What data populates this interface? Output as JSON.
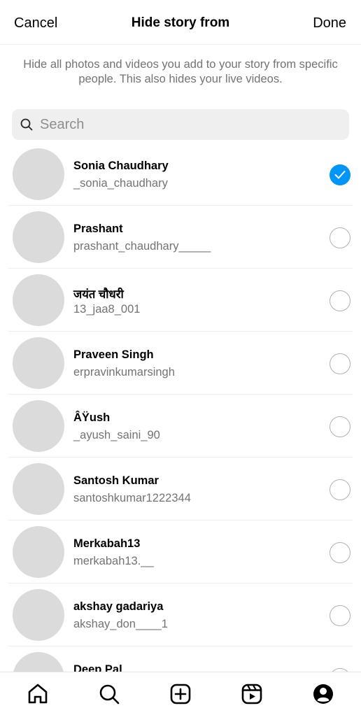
{
  "header": {
    "cancel_label": "Cancel",
    "title": "Hide story from",
    "done_label": "Done"
  },
  "description": "Hide all photos and videos you add to your story from specific people. This also hides your live videos.",
  "search": {
    "placeholder": "Search",
    "value": ""
  },
  "users": [
    {
      "name": "Sonia Chaudhary",
      "username": "_sonia_chaudhary",
      "selected": true
    },
    {
      "name": "Prashant",
      "username": "prashant_chaudhary_____",
      "selected": false
    },
    {
      "name": "जयंत चौधरी",
      "username": "13_jaa8_001",
      "selected": false
    },
    {
      "name": "Praveen Singh",
      "username": "erpravinkumarsingh",
      "selected": false
    },
    {
      "name": "ÂŸush",
      "username": "_ayush_saini_90",
      "selected": false
    },
    {
      "name": "Santosh Kumar",
      "username": "santoshkumar1222344",
      "selected": false
    },
    {
      "name": "Merkabah13",
      "username": "merkabah13.__",
      "selected": false
    },
    {
      "name": "akshay gadariya",
      "username": "akshay_don____1",
      "selected": false
    },
    {
      "name": "Deep Pal",
      "username": "",
      "selected": false
    }
  ],
  "bottom_nav": {
    "items": [
      {
        "icon": "home-icon"
      },
      {
        "icon": "search-icon"
      },
      {
        "icon": "create-icon"
      },
      {
        "icon": "reels-icon"
      },
      {
        "icon": "profile-icon"
      }
    ]
  },
  "colors": {
    "accent": "#0095f6",
    "secondary_text": "#737373",
    "avatar_placeholder": "#dbdbdb"
  }
}
